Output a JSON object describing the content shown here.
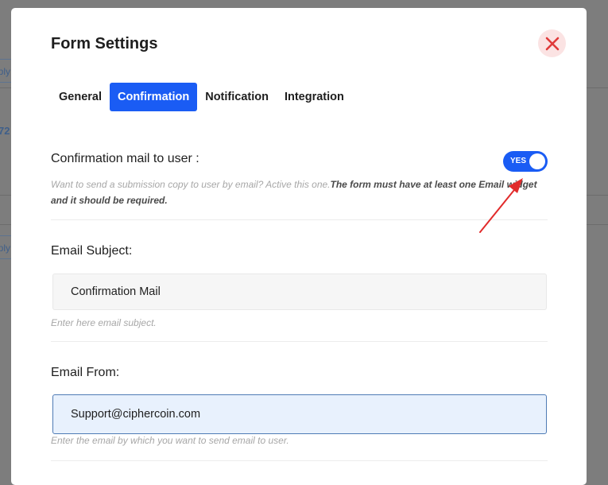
{
  "background": {
    "buttons": [
      "ply",
      "ply"
    ],
    "text": "72"
  },
  "modal": {
    "title": "Form Settings",
    "tabs": [
      {
        "label": "General",
        "active": false
      },
      {
        "label": "Confirmation",
        "active": true
      },
      {
        "label": "Notification",
        "active": false
      },
      {
        "label": "Integration",
        "active": false
      }
    ],
    "confirmation_mail": {
      "label": "Confirmation mail to user :",
      "toggle_label": "YES",
      "toggle_on": true,
      "hint": "Want to send a submission copy to user by email? Active this one.",
      "hint_strong": "The form must have at least one Email widget and it should be required."
    },
    "email_subject": {
      "label": "Email Subject:",
      "value": "Confirmation Mail",
      "hint": "Enter here email subject."
    },
    "email_from": {
      "label": "Email From:",
      "value": "Support@ciphercoin.com",
      "hint": "Enter the email by which you want to send email to user."
    }
  },
  "colors": {
    "accent": "#1a5cf4",
    "close": "#e03a3a",
    "close_bg": "#fbe3e3",
    "annotation_arrow": "#e12b2b"
  }
}
